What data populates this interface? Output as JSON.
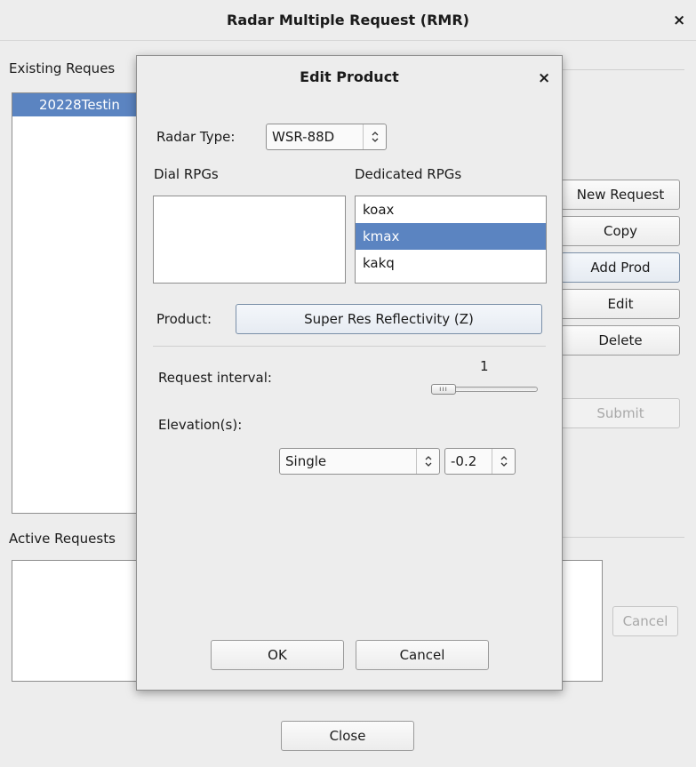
{
  "main": {
    "title": "Radar Multiple Request (RMR)",
    "close_glyph": "×",
    "existing_label": "Existing Reques",
    "existing_items": [
      "20228Testin"
    ],
    "active_label": "Active Requests",
    "buttons": {
      "new_request": "New Request",
      "copy": "Copy",
      "add_prod": "Add Prod",
      "edit": "Edit",
      "delete": "Delete",
      "submit": "Submit",
      "cancel": "Cancel",
      "close": "Close"
    }
  },
  "dialog": {
    "title": "Edit Product",
    "close_glyph": "×",
    "radar_type_label": "Radar Type:",
    "radar_type_value": "WSR-88D",
    "dial_rpgs_label": "Dial RPGs",
    "dedicated_rpgs_label": "Dedicated RPGs",
    "dedicated_rpgs": [
      "koax",
      "kmax",
      "kakq"
    ],
    "dedicated_selected": "kmax",
    "product_label": "Product:",
    "product_value": "Super Res Reflectivity (Z)",
    "request_interval_label": "Request interval:",
    "request_interval_value": "1",
    "request_interval_fraction": 0.0,
    "elevations_label": "Elevation(s):",
    "elevation_mode": "Single",
    "elevation_angle": "-0.2",
    "ok_label": "OK",
    "cancel_label": "Cancel"
  },
  "icons": {
    "select_arrow": "updown-chevron-icon",
    "slider_grip": "grip-icon"
  },
  "colors": {
    "selection": "#5b84c1",
    "background": "#ededed"
  }
}
